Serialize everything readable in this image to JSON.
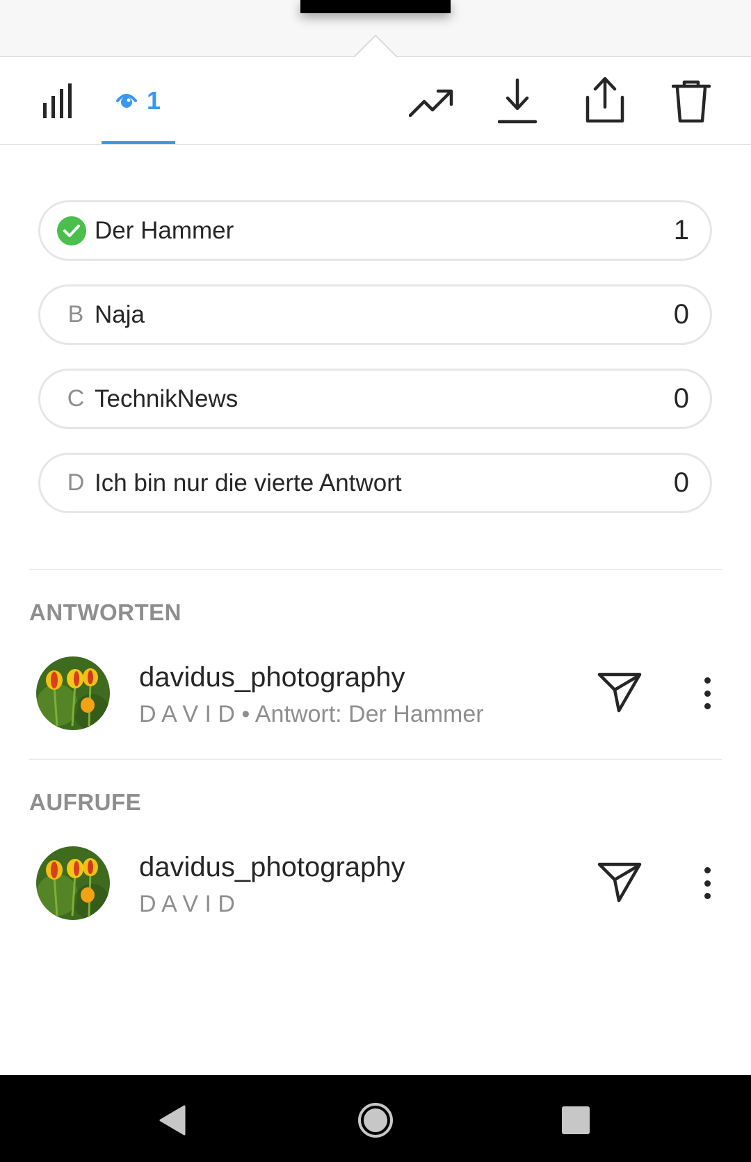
{
  "toolbar": {
    "views_count": "1"
  },
  "options": [
    {
      "letter": "",
      "text": "Der Hammer",
      "votes": "1",
      "correct": true
    },
    {
      "letter": "B",
      "text": "Naja",
      "votes": "0",
      "correct": false
    },
    {
      "letter": "C",
      "text": "TechnikNews",
      "votes": "0",
      "correct": false
    },
    {
      "letter": "D",
      "text": "Ich bin nur die vierte Antwort",
      "votes": "0",
      "correct": false
    }
  ],
  "answers": {
    "title": "ANTWORTEN",
    "items": [
      {
        "username": "davidus_photography",
        "display_name": "D A V I D",
        "detail": " • Antwort: Der Hammer"
      }
    ]
  },
  "views": {
    "title": "AUFRUFE",
    "items": [
      {
        "username": "davidus_photography",
        "display_name": "D A V I D"
      }
    ]
  },
  "colors": {
    "accent": "#3897f0",
    "correct": "#4bbf4b",
    "text": "#262626",
    "muted": "#8e8e8e"
  }
}
